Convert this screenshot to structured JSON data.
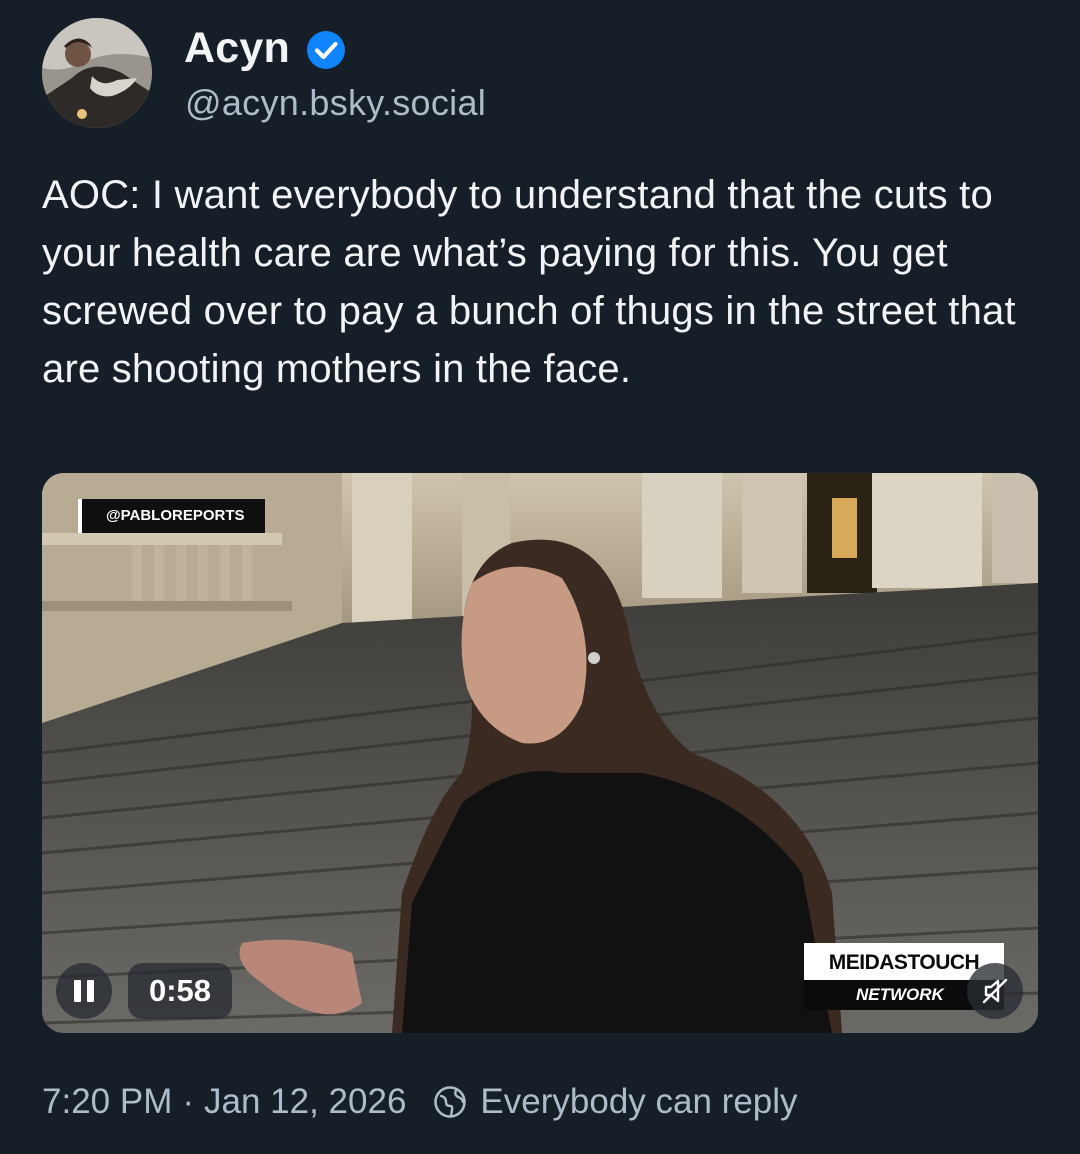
{
  "author": {
    "display_name": "Acyn",
    "handle": "@acyn.bsky.social",
    "verified_icon": "verified-check-icon",
    "avatar_icon": "avatar"
  },
  "post": {
    "text": "AOC: I want everybody to understand that the cuts to your health care are what’s paying for this. You get screwed over to pay a bunch of thugs in the street that are shooting mothers in the face."
  },
  "video": {
    "watermark": "@PABLOREPORTS",
    "brand_top": "MEIDASTOUCH",
    "brand_bottom": "NETWORK",
    "time": "0:58",
    "state": "playing",
    "muted": true
  },
  "footer": {
    "time": "7:20 PM",
    "separator": "·",
    "date": "Jan 12, 2026",
    "reply_setting": "Everybody can reply"
  },
  "colors": {
    "background": "#161e27",
    "accent": "#1083fe",
    "secondary_text": "#aebbc9"
  }
}
